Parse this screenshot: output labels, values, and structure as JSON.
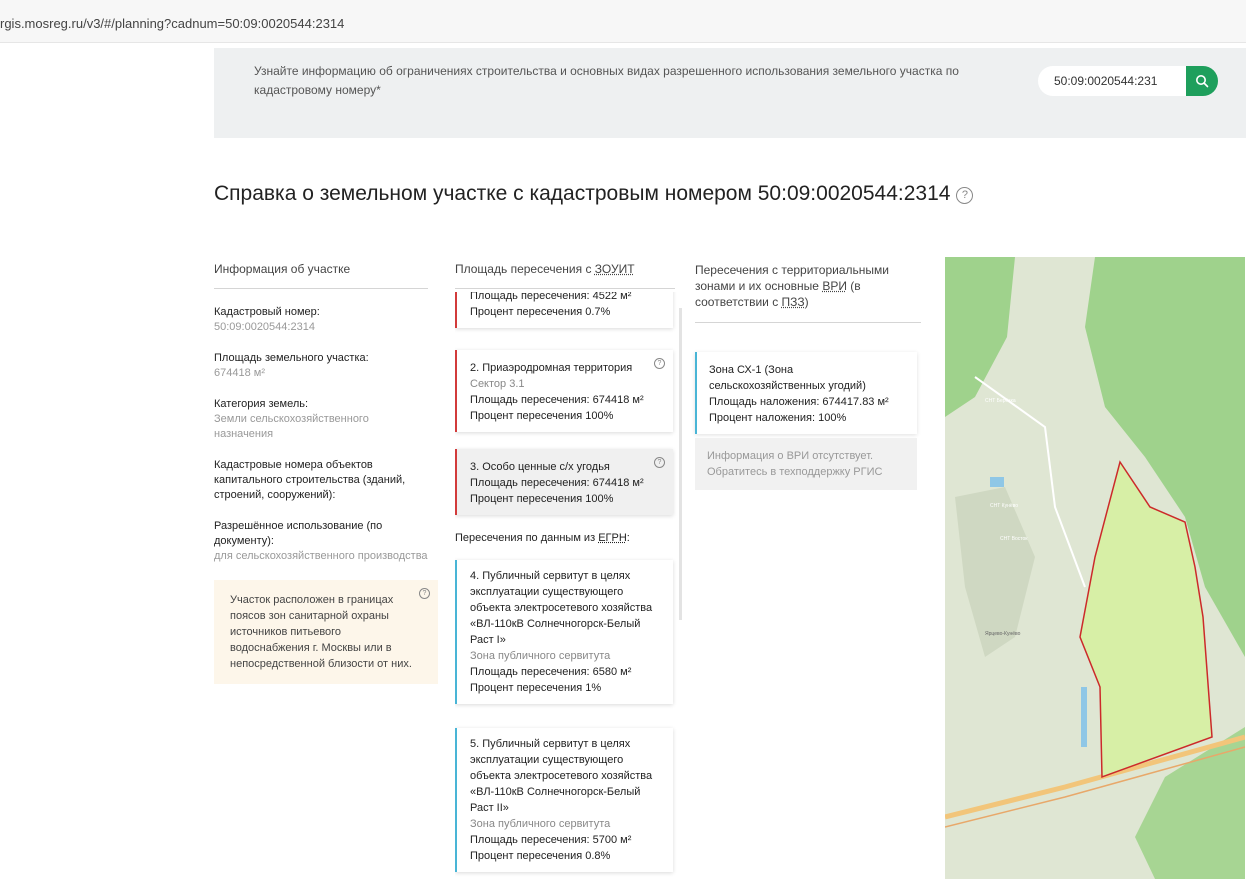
{
  "browser": {
    "url": "rgis.mosreg.ru/v3/#/planning?cadnum=50:09:0020544:2314"
  },
  "search": {
    "hint": "Узнайте информацию об ограничениях строительства и основных видах разрешенного использования земельного участка по кадастровому номеру*",
    "value": "50:09:0020544:231"
  },
  "page": {
    "title": "Справка о земельном участке с кадастровым номером 50:09:0020544:2314"
  },
  "parcel": {
    "header": "Информация об участке",
    "fields": [
      {
        "label": "Кадастровый номер:",
        "value": "50:09:0020544:2314"
      },
      {
        "label": "Площадь земельного участка:",
        "value": "674418 м²"
      },
      {
        "label": "Категория земель:",
        "value": "Земли сельскохозяйственного назначения"
      },
      {
        "label": "Кадастровые номера объектов капитального строительства (зданий, строений, сооружений):",
        "value": ""
      },
      {
        "label": "Разрешённое использование (по документу):",
        "value": "для сельскохозяйственного производства"
      }
    ],
    "note": "Участок расположен в границах поясов зон санитарной охраны источников питьевого водоснабжения г. Москвы или в непосредственной близости от них."
  },
  "zouit": {
    "header_prefix": "Площадь пересечения с ",
    "header_link": "ЗОУИТ",
    "cards": [
      {
        "title": "",
        "sub": "",
        "area": "Площадь пересечения: 4522 м²",
        "percent": "Процент пересечения 0.7%"
      },
      {
        "title": "2. Приаэродромная территория",
        "sub": "Сектор 3.1",
        "area": "Площадь пересечения: 674418 м²",
        "percent": "Процент пересечения 100%"
      },
      {
        "title": "3. Особо ценные с/х угодья",
        "sub": "",
        "area": "Площадь пересечения: 674418 м²",
        "percent": "Процент пересечения 100%"
      }
    ],
    "egrn_header_prefix": "Пересечения по данным из ",
    "egrn_header_link": "ЕГРН",
    "egrn_header_suffix": ":",
    "egrn_cards": [
      {
        "title": "4. Публичный сервитут в целях эксплуатации существующего объекта электросетевого хозяйства «ВЛ-110кВ Солнечногорск-Белый Раст I»",
        "sub": "Зона публичного сервитута",
        "area": "Площадь пересечения: 6580 м²",
        "percent": "Процент пересечения 1%"
      },
      {
        "title": "5. Публичный сервитут в целях эксплуатации существующего объекта электросетевого хозяйства «ВЛ-110кВ Солнечногорск-Белый Раст II»",
        "sub": "Зона публичного сервитута",
        "area": "Площадь пересечения: 5700 м²",
        "percent": "Процент пересечения 0.8%"
      }
    ]
  },
  "zones": {
    "header_prefix": "Пересечения с территориальными зонами и их основные ",
    "header_link1": "ВРИ",
    "header_mid": " (в соответствии с ",
    "header_link2": "ПЗЗ",
    "header_suffix": ")",
    "card": {
      "title": "Зона СХ-1 (Зона сельскохозяйственных угодий)",
      "area": "Площадь наложения: 674417.83 м²",
      "percent": "Процент наложения: 100%"
    },
    "info": "Информация о ВРИ отсутствует. Обратитесь в техподдержку РГИС"
  },
  "map": {
    "labels": [
      "СНТ Берёзка",
      "СНТ Кунёво",
      "СНТ Восток",
      "Ярцево-Кунёво"
    ],
    "parcel_fill": "#d7efa6",
    "parcel_stroke": "#cc2a2a"
  },
  "colors": {
    "accent": "#1e9f5c",
    "red_marker": "#d23b3b",
    "blue_marker": "#49b5d6"
  }
}
